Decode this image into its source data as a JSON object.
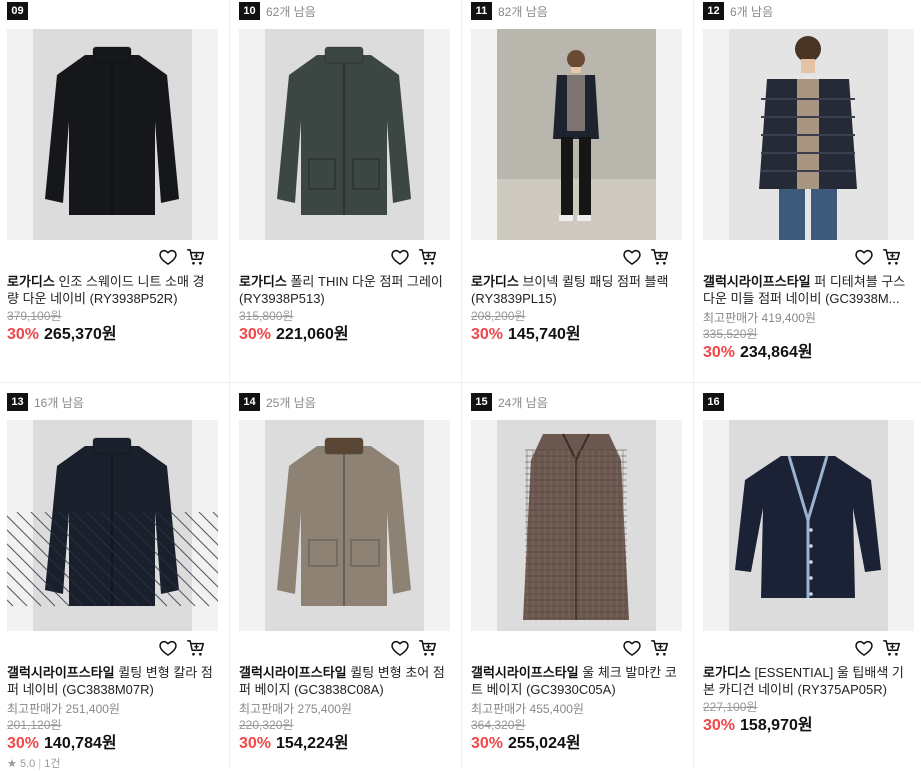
{
  "products": [
    {
      "rank": "09",
      "remaining": "",
      "brand": "로가디스",
      "name": "인조 스웨이드 니트 소매 경량 다운 네이비 (RY3938P52R)",
      "max_price": "",
      "original_price": "379,100원",
      "discount": "30%",
      "price": "265,370원",
      "rating": "",
      "review_count": "",
      "image": {
        "type": "jacket-zip",
        "bg": "#f2f2f2",
        "color": "#16171b",
        "panel": "#dcdcdc"
      }
    },
    {
      "rank": "10",
      "remaining": "62개 남음",
      "brand": "로가디스",
      "name": "폴리 THIN 다운 점퍼 그레이 (RY3938P513)",
      "max_price": "",
      "original_price": "315,800원",
      "discount": "30%",
      "price": "221,060원",
      "rating": "",
      "review_count": "",
      "image": {
        "type": "parka",
        "bg": "#f2f2f2",
        "color": "#3c4744",
        "panel": "#dcdcdc"
      }
    },
    {
      "rank": "11",
      "remaining": "82개 남음",
      "brand": "로가디스",
      "name": "브이넥 퀼팅 패딩 점퍼 블랙 (RY3839PL15)",
      "max_price": "",
      "original_price": "208,200원",
      "discount": "30%",
      "price": "145,740원",
      "rating": "",
      "review_count": "",
      "image": {
        "type": "model-wall",
        "bg": "#f2f2f2",
        "color": "#1d2430",
        "panel": "#b9b6ae"
      }
    },
    {
      "rank": "12",
      "remaining": "6개 남음",
      "brand": "갤럭시라이프스타일",
      "name": "퍼 디테쳐블 구스다운 미들 점퍼 네이비 (GC3938M...",
      "max_price": "최고판매가 419,400원",
      "original_price": "335,520원",
      "discount": "30%",
      "price": "234,864원",
      "rating": "",
      "review_count": "",
      "image": {
        "type": "model-down",
        "bg": "#f2f2f2",
        "color": "#262a36",
        "panel": "#e4e4e4"
      }
    },
    {
      "rank": "13",
      "remaining": "16개 남음",
      "brand": "갤럭시라이프스타일",
      "name": "퀼팅 변형 칼라 점퍼 네이비 (GC3838M07R)",
      "max_price": "최고판매가 251,400원",
      "original_price": "201,120원",
      "discount": "30%",
      "price": "140,784원",
      "rating": "5.0",
      "review_count": "1건",
      "image": {
        "type": "quilted",
        "bg": "#f2f2f2",
        "color": "#1a1f2c",
        "panel": "#dcdcdc"
      }
    },
    {
      "rank": "14",
      "remaining": "25개 남음",
      "brand": "갤럭시라이프스타일",
      "name": "퀼팅 변형 초어 점퍼 베이지 (GC3838C08A)",
      "max_price": "최고판매가 275,400원",
      "original_price": "220,320원",
      "discount": "30%",
      "price": "154,224원",
      "rating": "",
      "review_count": "",
      "image": {
        "type": "chore",
        "bg": "#f2f2f2",
        "color": "#8d8274",
        "panel": "#dcdcdc"
      }
    },
    {
      "rank": "15",
      "remaining": "24개 남음",
      "brand": "갤럭시라이프스타일",
      "name": "울 체크 발마칸 코트 베이지 (GC3930C05A)",
      "max_price": "최고판매가 455,400원",
      "original_price": "364,320원",
      "discount": "30%",
      "price": "255,024원",
      "rating": "",
      "review_count": "",
      "image": {
        "type": "coat",
        "bg": "#f2f2f2",
        "color": "#6b5850",
        "panel": "#dcdcdc"
      }
    },
    {
      "rank": "16",
      "remaining": "",
      "brand": "로가디스",
      "name": "[ESSENTIAL] 울 팁배색 기본 카디건 네이비 (RY375AP05R)",
      "max_price": "",
      "original_price": "227,100원",
      "discount": "30%",
      "price": "158,970원",
      "rating": "",
      "review_count": "",
      "image": {
        "type": "cardigan",
        "bg": "#f2f2f2",
        "color": "#1b2236",
        "panel": "#dcdcdc"
      }
    }
  ],
  "colors": {
    "discount": "#f1474a",
    "rank_bg": "#111111",
    "muted": "#888888"
  },
  "icons": {
    "wish": "heart-icon",
    "cart": "cart-icon",
    "star": "star-icon"
  }
}
